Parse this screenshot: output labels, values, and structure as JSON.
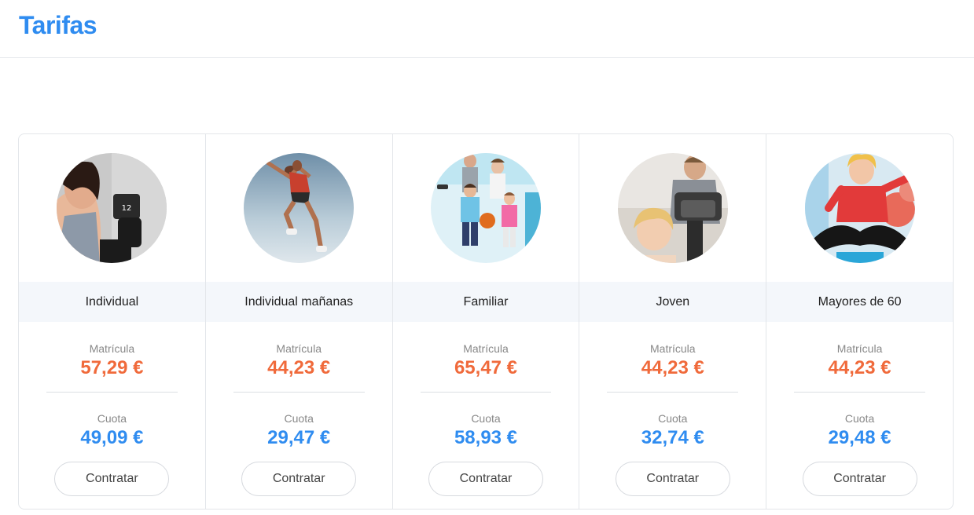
{
  "page": {
    "title": "Tarifas"
  },
  "plans": [
    {
      "name": "Individual",
      "enroll_label": "Matrícula",
      "enroll_price": "57,29 €",
      "fee_label": "Cuota",
      "fee_price": "49,09 €",
      "button": "Contratar"
    },
    {
      "name": "Individual mañanas",
      "enroll_label": "Matrícula",
      "enroll_price": "44,23 €",
      "fee_label": "Cuota",
      "fee_price": "29,47 €",
      "button": "Contratar"
    },
    {
      "name": "Familiar",
      "enroll_label": "Matrícula",
      "enroll_price": "65,47 €",
      "fee_label": "Cuota",
      "fee_price": "58,93 €",
      "button": "Contratar"
    },
    {
      "name": "Joven",
      "enroll_label": "Matrícula",
      "enroll_price": "44,23 €",
      "fee_label": "Cuota",
      "fee_price": "32,74 €",
      "button": "Contratar"
    },
    {
      "name": "Mayores de 60",
      "enroll_label": "Matrícula",
      "enroll_price": "44,23 €",
      "fee_label": "Cuota",
      "fee_price": "29,48 €",
      "button": "Contratar"
    }
  ],
  "colors": {
    "title": "#2f8cf0",
    "enroll_price": "#f06a3b",
    "fee_price": "#2f8cf0"
  }
}
